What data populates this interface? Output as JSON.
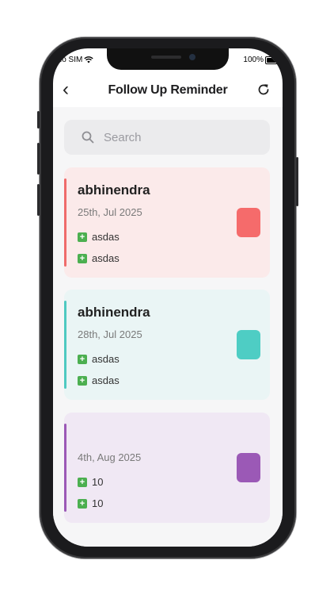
{
  "status": {
    "carrier": "No SIM",
    "battery": "100%"
  },
  "header": {
    "title": "Follow Up Reminder"
  },
  "search": {
    "placeholder": "Search"
  },
  "colors": {
    "card1_bg": "#fbeaea",
    "card1_accent": "#ef6b6b",
    "card1_swatch": "#f56b6b",
    "card2_bg": "#eaf5f5",
    "card2_accent": "#4ec9c1",
    "card2_swatch": "#4ecdc4",
    "card3_bg": "#f0e8f4",
    "card3_accent": "#9b59b6",
    "card3_swatch": "#9b59b6",
    "tag": "#4caf50"
  },
  "reminders": [
    {
      "name": "abhinendra",
      "date": "25th, Jul 2025",
      "items": [
        "asdas",
        "asdas"
      ]
    },
    {
      "name": "abhinendra",
      "date": "28th, Jul 2025",
      "items": [
        "asdas",
        "asdas"
      ]
    },
    {
      "name": "",
      "date": "4th, Aug 2025",
      "items": [
        "10",
        "10"
      ]
    }
  ]
}
